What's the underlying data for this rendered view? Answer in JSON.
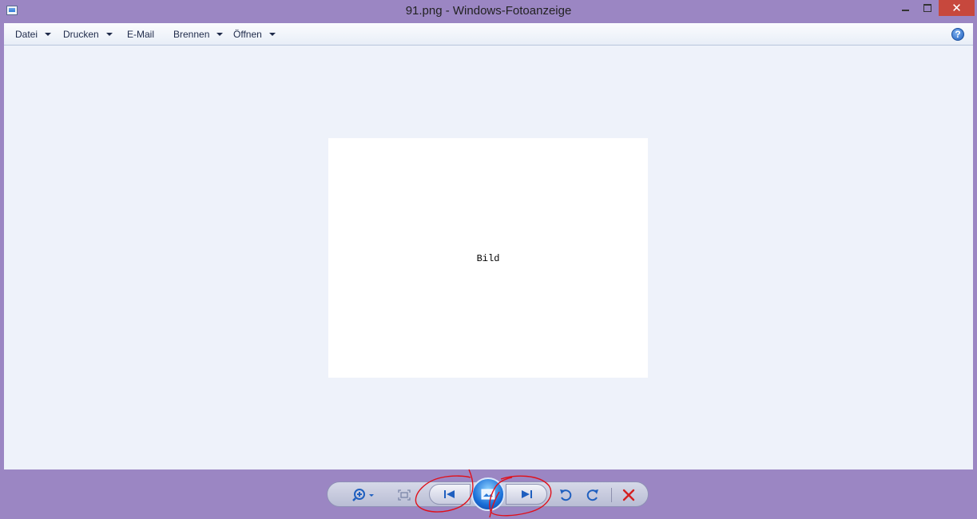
{
  "window": {
    "title": "91.png - Windows-Fotoanzeige",
    "controls": {
      "minimize": "minimize-icon",
      "maximize": "maximize-icon",
      "close": "✕"
    }
  },
  "menu": {
    "items": [
      {
        "label": "Datei",
        "has_dropdown": true
      },
      {
        "label": "Drucken",
        "has_dropdown": true
      },
      {
        "label": "E-Mail",
        "has_dropdown": false
      },
      {
        "label": "Brennen",
        "has_dropdown": true
      },
      {
        "label": "Öffnen",
        "has_dropdown": true
      }
    ],
    "help": "?"
  },
  "image": {
    "caption": "Bild",
    "background": "#ffffff"
  },
  "toolbar": {
    "icons": [
      "zoom-icon",
      "fit-to-window-icon",
      "previous-icon",
      "slideshow-icon",
      "next-icon",
      "rotate-left-icon",
      "rotate-right-icon",
      "delete-icon"
    ]
  },
  "colors": {
    "frame": "#9b86c3",
    "viewer_bg": "#eef2fa",
    "accent_blue": "#1f5fbf",
    "delete_red": "#d42020",
    "annotation_red": "#e0101a"
  }
}
